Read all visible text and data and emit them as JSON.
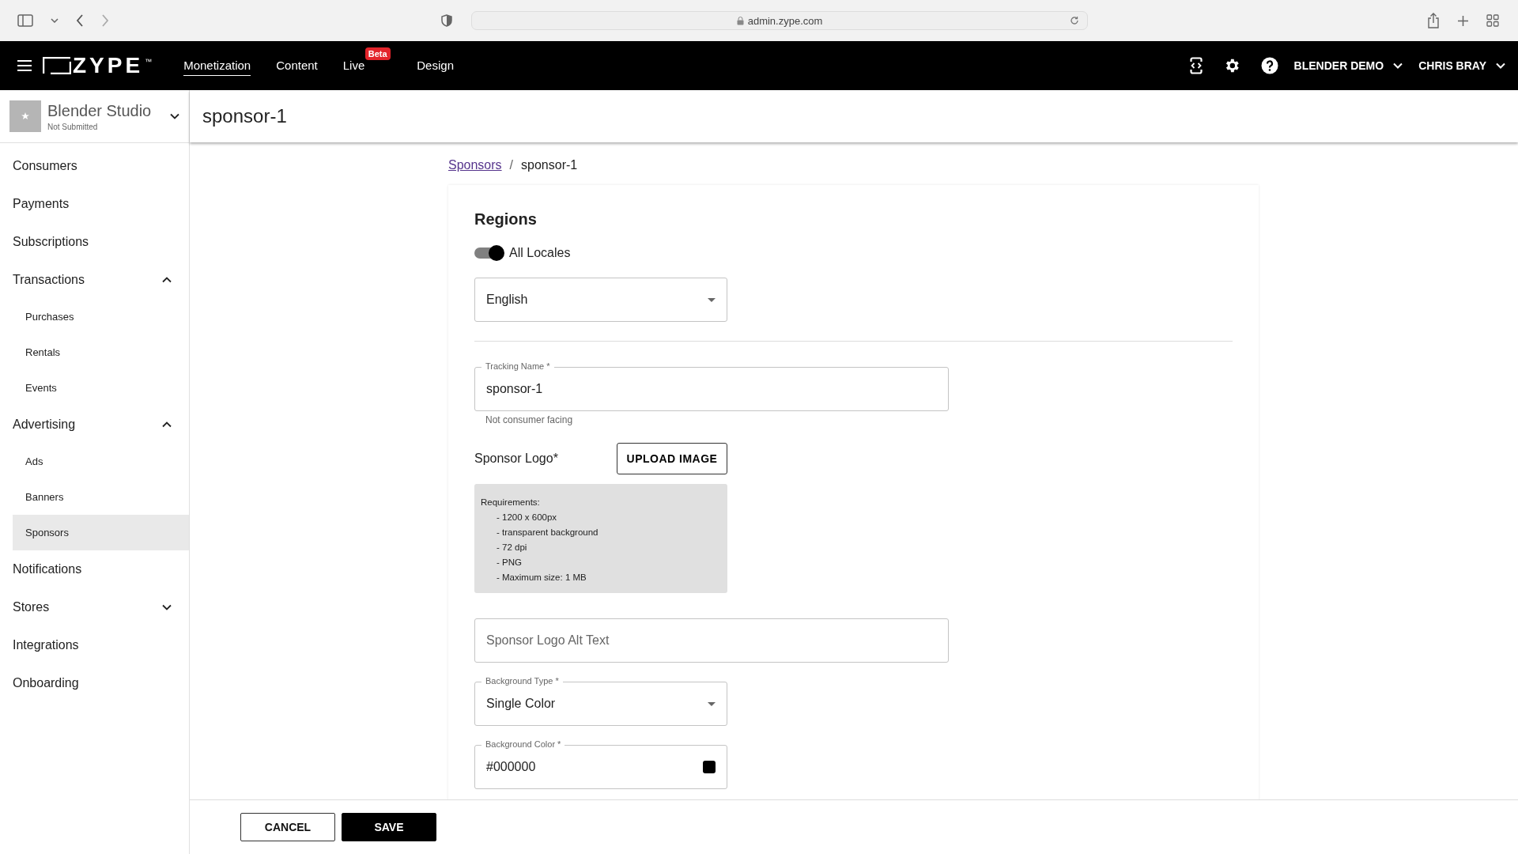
{
  "browser": {
    "url": "admin.zype.com"
  },
  "nav": {
    "logo": "ZYPE",
    "trademark": "™",
    "items": [
      {
        "label": "Monetization",
        "selected": true
      },
      {
        "label": "Content",
        "selected": false
      },
      {
        "label": "Live",
        "selected": false,
        "badge": "Beta"
      },
      {
        "label": "Design",
        "selected": false
      }
    ],
    "account": "BLENDER DEMO",
    "user": "CHRIS BRAY"
  },
  "org": {
    "name": "Blender Studio",
    "status": "Not Submitted"
  },
  "sidebar": {
    "items": [
      {
        "label": "Consumers",
        "selected": false
      },
      {
        "label": "Payments",
        "selected": false
      },
      {
        "label": "Subscriptions",
        "selected": false
      },
      {
        "label": "Transactions",
        "selected": false,
        "expanded": true,
        "children": [
          {
            "label": "Purchases",
            "selected": false
          },
          {
            "label": "Rentals",
            "selected": false
          },
          {
            "label": "Events",
            "selected": false
          }
        ]
      },
      {
        "label": "Advertising",
        "selected": false,
        "expanded": true,
        "children": [
          {
            "label": "Ads",
            "selected": false
          },
          {
            "label": "Banners",
            "selected": false
          },
          {
            "label": "Sponsors",
            "selected": true
          }
        ]
      },
      {
        "label": "Notifications",
        "selected": false
      },
      {
        "label": "Stores",
        "selected": false,
        "expanded": false
      },
      {
        "label": "Integrations",
        "selected": false
      },
      {
        "label": "Onboarding",
        "selected": false
      }
    ]
  },
  "page": {
    "title": "sponsor-1"
  },
  "breadcrumb": {
    "separator": "/",
    "items": [
      {
        "label": "Sponsors",
        "kind": "link"
      },
      {
        "label": "sponsor-1",
        "kind": "current"
      }
    ]
  },
  "form": {
    "section_title": "Regions",
    "all_locales": {
      "label": "All Locales",
      "on": true
    },
    "locale_select": {
      "value": "English"
    },
    "tracking_name": {
      "label": "Tracking Name *",
      "value": "sponsor-1",
      "helper": "Not consumer facing"
    },
    "sponsor_logo": {
      "label": "Sponsor Logo*",
      "button": "UPLOAD IMAGE",
      "requirements_title": "Requirements:",
      "requirements": [
        "- 1200 x 600px",
        "- transparent background",
        "- 72 dpi",
        "- PNG",
        "- Maximum size: 1 MB"
      ]
    },
    "alt_text": {
      "placeholder": "Sponsor Logo Alt Text"
    },
    "background_type": {
      "label": "Background Type *",
      "value": "Single Color"
    },
    "background_color": {
      "label": "Background Color *",
      "value": "#000000",
      "color": "#000000"
    }
  },
  "footer": {
    "buttons": [
      {
        "label": "CANCEL",
        "kind": "secondary"
      },
      {
        "label": "SAVE",
        "kind": "primary"
      }
    ]
  }
}
